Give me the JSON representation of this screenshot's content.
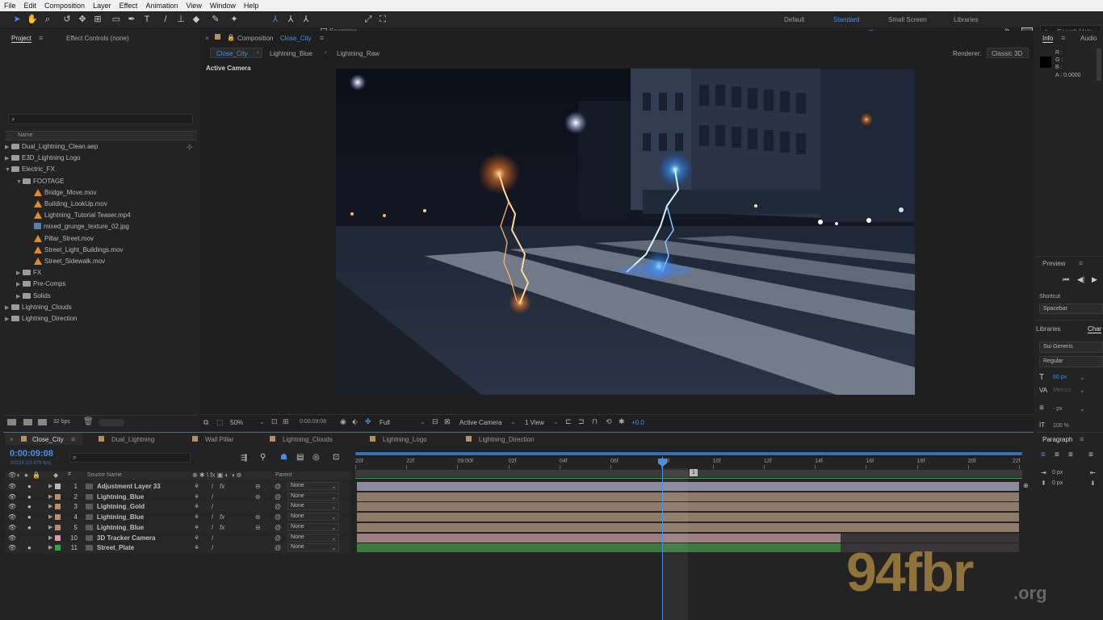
{
  "menu": [
    "File",
    "Edit",
    "Composition",
    "Layer",
    "Effect",
    "Animation",
    "View",
    "Window",
    "Help"
  ],
  "toolbar": {
    "snapping": "Snapping",
    "workspaces": [
      "Default",
      "Standard",
      "Small Screen",
      "Libraries"
    ],
    "active_workspace": "Standard",
    "search_help": "Search Help"
  },
  "project": {
    "tab_project": "Project",
    "tab_effect_controls": "Effect Controls (none)",
    "search_placeholder": "",
    "column_name": "Name",
    "items": [
      {
        "label": "Dual_Lightning_Clean.aep",
        "type": "folder",
        "indent": 0,
        "tri": "▶"
      },
      {
        "label": "E3D_Lightning Logo",
        "type": "folder",
        "indent": 0,
        "tri": "▶"
      },
      {
        "label": "Electric_FX",
        "type": "folder",
        "indent": 0,
        "tri": "▼"
      },
      {
        "label": "FOOTAGE",
        "type": "folder",
        "indent": 1,
        "tri": "▼"
      },
      {
        "label": "Bridge_Move.mov",
        "type": "mov",
        "indent": 2,
        "tri": ""
      },
      {
        "label": "Building_LookUp.mov",
        "type": "mov",
        "indent": 2,
        "tri": ""
      },
      {
        "label": "Lightning_Tutorial Teaser.mp4",
        "type": "mov",
        "indent": 2,
        "tri": ""
      },
      {
        "label": "mixed_grunge_texture_02.jpg",
        "type": "jpg",
        "indent": 2,
        "tri": ""
      },
      {
        "label": "Pillar_Street.mov",
        "type": "mov",
        "indent": 2,
        "tri": ""
      },
      {
        "label": "Street_Light_Buildings.mov",
        "type": "mov",
        "indent": 2,
        "tri": ""
      },
      {
        "label": "Street_Sidewalk.mov",
        "type": "mov",
        "indent": 2,
        "tri": ""
      },
      {
        "label": "FX",
        "type": "folder",
        "indent": 1,
        "tri": "▶"
      },
      {
        "label": "Pre-Comps",
        "type": "folder",
        "indent": 1,
        "tri": "▶"
      },
      {
        "label": "Solids",
        "type": "folder",
        "indent": 1,
        "tri": "▶"
      },
      {
        "label": "Lightning_Clouds",
        "type": "folder",
        "indent": 0,
        "tri": "▶"
      },
      {
        "label": "Lightning_Direction",
        "type": "folder",
        "indent": 0,
        "tri": "▶"
      }
    ],
    "bpc": "32 bpc"
  },
  "composition": {
    "title_prefix": "Composition",
    "title_name": "Close_City",
    "breadcrumbs": [
      "Close_City",
      "Lightning_Blue",
      "Lightning_Raw"
    ],
    "renderer_label": "Renderer:",
    "renderer_value": "Classic 3D",
    "active_camera_label": "Active Camera",
    "zoom": "50%",
    "timecode": "0:00:09:08",
    "resolution": "Full",
    "camera_select": "Active Camera",
    "view_select": "1 View",
    "exposure": "+0.0"
  },
  "timeline": {
    "tabs": [
      "Close_City",
      "Dual_Lightning",
      "Wall Pillar",
      "Lightning_Clouds",
      "Lightning_Logo",
      "Lightning_Direction"
    ],
    "tab_colors": [
      "#b09070",
      "#b09070",
      "#b09070",
      "#b09070",
      "#b09070",
      "#b09070"
    ],
    "timecode": "0:00:09:08",
    "fps": "00224 (23.976 fps)",
    "col_source": "Source Name",
    "col_parent": "Parent",
    "ruler": [
      "20f",
      "22f",
      "09:00f",
      "02f",
      "04f",
      "06f",
      "08f",
      "10f",
      "12f",
      "14f",
      "16f",
      "18f",
      "20f",
      "22f"
    ],
    "layers": [
      {
        "num": "1",
        "name": "Adjustment Layer 33",
        "color": "#b8b8b8",
        "bar": "#8a8aa0",
        "fx": "fx",
        "parent": "None",
        "end": 1.0
      },
      {
        "num": "2",
        "name": "Lightning_Blue",
        "color": "#b09070",
        "bar": "#8e7a68",
        "fx": "",
        "parent": "None",
        "end": 1.0
      },
      {
        "num": "3",
        "name": "Lightning_Gold",
        "color": "#b09070",
        "bar": "#8e7a68",
        "fx": "",
        "parent": "None",
        "end": 1.0
      },
      {
        "num": "4",
        "name": "Lightning_Blue",
        "color": "#b09070",
        "bar": "#8e7a68",
        "fx": "fx",
        "parent": "None",
        "end": 1.0
      },
      {
        "num": "5",
        "name": "Lightning_Blue",
        "color": "#b09070",
        "bar": "#8e7a68",
        "fx": "fx",
        "parent": "None",
        "end": 1.0
      },
      {
        "num": "10",
        "name": "3D Tracker Camera",
        "color": "#d8a0a8",
        "bar": "#9c7e82",
        "fx": "",
        "parent": "None",
        "end": 0.73
      },
      {
        "num": "11",
        "name": "Street_Plate",
        "color": "#3fa04a",
        "bar": "#3d7a3f",
        "fx": "",
        "parent": "None",
        "end": 0.73
      }
    ]
  },
  "info": {
    "tab_info": "Info",
    "tab_audio": "Audio",
    "r": "R :",
    "g": "G :",
    "b": "B :",
    "a": "A :  0.0000"
  },
  "preview": {
    "title": "Preview",
    "shortcut_label": "Shortcut",
    "shortcut_value": "Spacebar"
  },
  "character": {
    "tab_libraries": "Libraries",
    "tab_character": "Char",
    "font": "Sui Generis",
    "style": "Regular",
    "size": "60 px",
    "tracking": "Metrics",
    "stroke": "- px",
    "scale": "100 %"
  },
  "paragraph": {
    "title": "Paragraph",
    "indent1": "0 px",
    "indent2": "0 px"
  },
  "watermark": {
    "main": "94fbr",
    "suffix": ".org"
  }
}
